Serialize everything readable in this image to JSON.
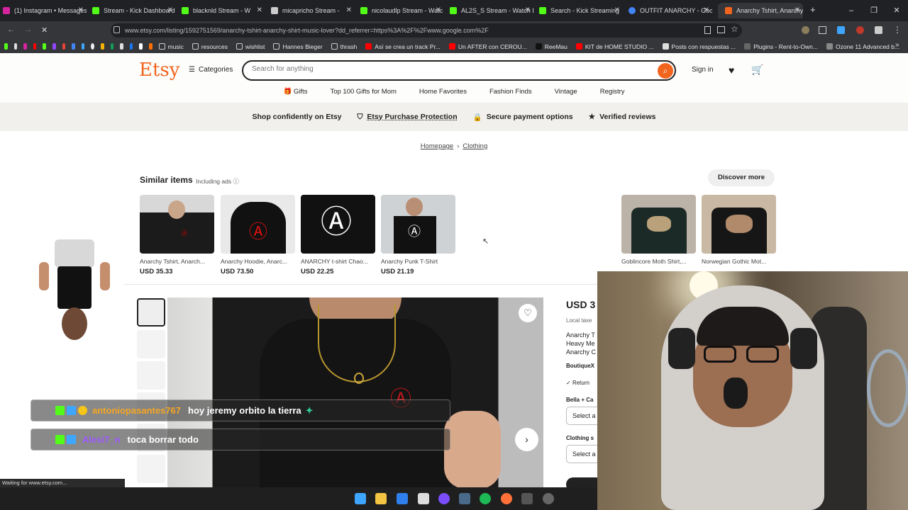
{
  "browser": {
    "tabs": [
      {
        "label": "(1) Instagram • Messages",
        "color": "#d6249f"
      },
      {
        "label": "Stream - Kick Dashboard",
        "color": "#53fc18"
      },
      {
        "label": "blacknld Stream - W",
        "color": "#53fc18"
      },
      {
        "label": "micapricho Stream -",
        "color": "#cccccc"
      },
      {
        "label": "nicolaudlp Stream - Watc",
        "color": "#53fc18"
      },
      {
        "label": "AL2S_S Stream - Watch L",
        "color": "#53fc18"
      },
      {
        "label": "Search - Kick Streaming",
        "color": "#53fc18"
      },
      {
        "label": "OUTFIT ANARCHY - Goo",
        "color": "#4285f4"
      },
      {
        "label": "Anarchy Tshirt, Anarchy S",
        "color": "#f1641e"
      }
    ],
    "url": "www.etsy.com/listing/1592751569/anarchy-tshirt-anarchy-shirt-music-lover?dd_referrer=https%3A%2F%2Fwww.google.com%2F",
    "bookmarks": [
      "music",
      "resources",
      "wishlist",
      "Hannes Bieger",
      "thrash",
      "Así se crea un track Pr...",
      "Un AFTER con CEROU...",
      "ReeMau",
      "KIT de HOME STUDIO ...",
      "Posts con respuestas ...",
      "Plugins - Rent-to-Own...",
      "Ozone 11 Advanced b..."
    ],
    "status": "Waiting for www.etsy.com..."
  },
  "etsy": {
    "logo": "Etsy",
    "categories_label": "Categories",
    "search_placeholder": "Search for anything",
    "signin": "Sign in",
    "nav": [
      "Gifts",
      "Top 100 Gifts for Mom",
      "Home Favorites",
      "Fashion Finds",
      "Vintage",
      "Registry"
    ],
    "trust": [
      "Shop confidently on Etsy",
      "Etsy Purchase Protection",
      "Secure payment options",
      "Verified reviews"
    ],
    "breadcrumb": [
      "Homepage",
      "Clothing"
    ],
    "similar": {
      "title": "Similar items",
      "subtitle": "Including ads",
      "discover": "Discover more",
      "items": [
        {
          "title": "Anarchy Tshirt, Anarch...",
          "price": "USD 35.33"
        },
        {
          "title": "Anarchy Hoodie, Anarc...",
          "price": "USD 73.50"
        },
        {
          "title": "ANARCHY t-shirt Chao...",
          "price": "USD 22.25"
        },
        {
          "title": "Anarchy Punk T-Shirt",
          "price": "USD 21.19"
        },
        {
          "title": "Goblincore Moth Shirt,...",
          "price": ""
        },
        {
          "title": "Norwegian Gothic Mot...",
          "price": ""
        }
      ]
    },
    "listing": {
      "price": "USD 3",
      "tax_note": "Local taxe",
      "title_lines": [
        "Anarchy T",
        "Heavy Me",
        "Anarchy C"
      ],
      "shop": "BoutiqueX",
      "returns": "Return",
      "variant1_label": "Bella + Ca",
      "variant1_value": "Select a",
      "variant2_label": "Clothing s",
      "variant2_value": "Select a"
    }
  },
  "chat": [
    {
      "user": "antoniopasantes767",
      "message": "hoy jeremy orbito la tierra",
      "user_color": "#f5a623"
    },
    {
      "user": "Alesi7_n",
      "message": "toca borrar todo",
      "user_color": "#9b59ff"
    }
  ]
}
